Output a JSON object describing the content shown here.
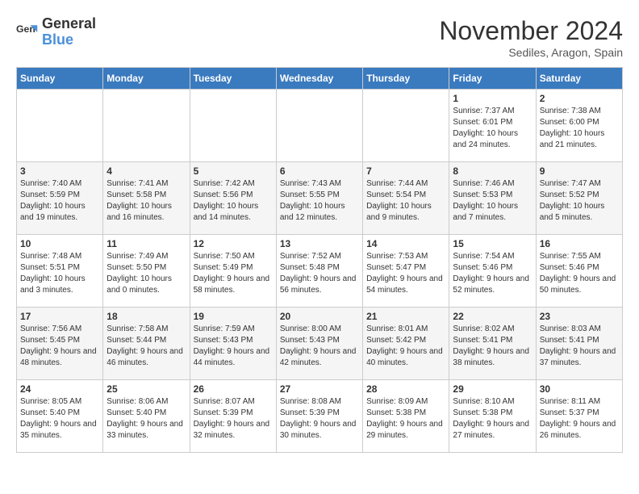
{
  "header": {
    "logo_line1": "General",
    "logo_line2": "Blue",
    "month_title": "November 2024",
    "subtitle": "Sediles, Aragon, Spain"
  },
  "weekdays": [
    "Sunday",
    "Monday",
    "Tuesday",
    "Wednesday",
    "Thursday",
    "Friday",
    "Saturday"
  ],
  "weeks": [
    [
      {
        "day": "",
        "info": ""
      },
      {
        "day": "",
        "info": ""
      },
      {
        "day": "",
        "info": ""
      },
      {
        "day": "",
        "info": ""
      },
      {
        "day": "",
        "info": ""
      },
      {
        "day": "1",
        "info": "Sunrise: 7:37 AM\nSunset: 6:01 PM\nDaylight: 10 hours and 24 minutes."
      },
      {
        "day": "2",
        "info": "Sunrise: 7:38 AM\nSunset: 6:00 PM\nDaylight: 10 hours and 21 minutes."
      }
    ],
    [
      {
        "day": "3",
        "info": "Sunrise: 7:40 AM\nSunset: 5:59 PM\nDaylight: 10 hours and 19 minutes."
      },
      {
        "day": "4",
        "info": "Sunrise: 7:41 AM\nSunset: 5:58 PM\nDaylight: 10 hours and 16 minutes."
      },
      {
        "day": "5",
        "info": "Sunrise: 7:42 AM\nSunset: 5:56 PM\nDaylight: 10 hours and 14 minutes."
      },
      {
        "day": "6",
        "info": "Sunrise: 7:43 AM\nSunset: 5:55 PM\nDaylight: 10 hours and 12 minutes."
      },
      {
        "day": "7",
        "info": "Sunrise: 7:44 AM\nSunset: 5:54 PM\nDaylight: 10 hours and 9 minutes."
      },
      {
        "day": "8",
        "info": "Sunrise: 7:46 AM\nSunset: 5:53 PM\nDaylight: 10 hours and 7 minutes."
      },
      {
        "day": "9",
        "info": "Sunrise: 7:47 AM\nSunset: 5:52 PM\nDaylight: 10 hours and 5 minutes."
      }
    ],
    [
      {
        "day": "10",
        "info": "Sunrise: 7:48 AM\nSunset: 5:51 PM\nDaylight: 10 hours and 3 minutes."
      },
      {
        "day": "11",
        "info": "Sunrise: 7:49 AM\nSunset: 5:50 PM\nDaylight: 10 hours and 0 minutes."
      },
      {
        "day": "12",
        "info": "Sunrise: 7:50 AM\nSunset: 5:49 PM\nDaylight: 9 hours and 58 minutes."
      },
      {
        "day": "13",
        "info": "Sunrise: 7:52 AM\nSunset: 5:48 PM\nDaylight: 9 hours and 56 minutes."
      },
      {
        "day": "14",
        "info": "Sunrise: 7:53 AM\nSunset: 5:47 PM\nDaylight: 9 hours and 54 minutes."
      },
      {
        "day": "15",
        "info": "Sunrise: 7:54 AM\nSunset: 5:46 PM\nDaylight: 9 hours and 52 minutes."
      },
      {
        "day": "16",
        "info": "Sunrise: 7:55 AM\nSunset: 5:46 PM\nDaylight: 9 hours and 50 minutes."
      }
    ],
    [
      {
        "day": "17",
        "info": "Sunrise: 7:56 AM\nSunset: 5:45 PM\nDaylight: 9 hours and 48 minutes."
      },
      {
        "day": "18",
        "info": "Sunrise: 7:58 AM\nSunset: 5:44 PM\nDaylight: 9 hours and 46 minutes."
      },
      {
        "day": "19",
        "info": "Sunrise: 7:59 AM\nSunset: 5:43 PM\nDaylight: 9 hours and 44 minutes."
      },
      {
        "day": "20",
        "info": "Sunrise: 8:00 AM\nSunset: 5:43 PM\nDaylight: 9 hours and 42 minutes."
      },
      {
        "day": "21",
        "info": "Sunrise: 8:01 AM\nSunset: 5:42 PM\nDaylight: 9 hours and 40 minutes."
      },
      {
        "day": "22",
        "info": "Sunrise: 8:02 AM\nSunset: 5:41 PM\nDaylight: 9 hours and 38 minutes."
      },
      {
        "day": "23",
        "info": "Sunrise: 8:03 AM\nSunset: 5:41 PM\nDaylight: 9 hours and 37 minutes."
      }
    ],
    [
      {
        "day": "24",
        "info": "Sunrise: 8:05 AM\nSunset: 5:40 PM\nDaylight: 9 hours and 35 minutes."
      },
      {
        "day": "25",
        "info": "Sunrise: 8:06 AM\nSunset: 5:40 PM\nDaylight: 9 hours and 33 minutes."
      },
      {
        "day": "26",
        "info": "Sunrise: 8:07 AM\nSunset: 5:39 PM\nDaylight: 9 hours and 32 minutes."
      },
      {
        "day": "27",
        "info": "Sunrise: 8:08 AM\nSunset: 5:39 PM\nDaylight: 9 hours and 30 minutes."
      },
      {
        "day": "28",
        "info": "Sunrise: 8:09 AM\nSunset: 5:38 PM\nDaylight: 9 hours and 29 minutes."
      },
      {
        "day": "29",
        "info": "Sunrise: 8:10 AM\nSunset: 5:38 PM\nDaylight: 9 hours and 27 minutes."
      },
      {
        "day": "30",
        "info": "Sunrise: 8:11 AM\nSunset: 5:37 PM\nDaylight: 9 hours and 26 minutes."
      }
    ]
  ]
}
